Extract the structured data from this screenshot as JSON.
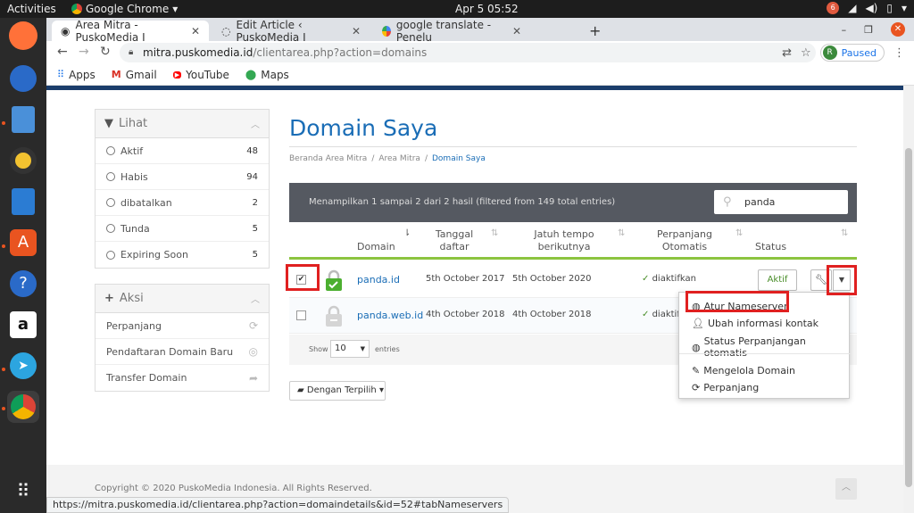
{
  "system": {
    "activities": "Activities",
    "app": "Google Chrome",
    "clock": "Apr 5  05:52",
    "notif_count": "6"
  },
  "browser": {
    "tabs": [
      {
        "title": "Area Mitra - PuskoMedia I",
        "active": true
      },
      {
        "title": "Edit Article ‹ PuskoMedia I",
        "active": false
      },
      {
        "title": "google translate - Penelu",
        "active": false
      }
    ],
    "url_host": "mitra.puskomedia.id",
    "url_path": "/clientarea.php?action=domains",
    "profile_initial": "R",
    "profile_status": "Paused",
    "bookmarks": [
      "Apps",
      "Gmail",
      "YouTube",
      "Maps"
    ],
    "status_url": "https://mitra.puskomedia.id/clientarea.php?action=domaindetails&id=52#tabNameservers"
  },
  "sidebar": {
    "lihat": {
      "title": "Lihat",
      "items": [
        {
          "label": "Aktif",
          "count": "48"
        },
        {
          "label": "Habis",
          "count": "94"
        },
        {
          "label": "dibatalkan",
          "count": "2"
        },
        {
          "label": "Tunda",
          "count": "5"
        },
        {
          "label": "Expiring Soon",
          "count": "5"
        }
      ]
    },
    "aksi": {
      "title": "Aksi",
      "items": [
        {
          "label": "Perpanjang"
        },
        {
          "label": "Pendaftaran Domain Baru"
        },
        {
          "label": "Transfer Domain"
        }
      ]
    }
  },
  "main": {
    "title": "Domain Saya",
    "breadcrumb": [
      "Beranda Area Mitra",
      "Area Mitra",
      "Domain Saya"
    ],
    "table_info": "Menampilkan 1 sampai 2 dari 2 hasil (filtered from 149 total entries)",
    "search_value": "panda",
    "columns": {
      "domain": "Domain",
      "reg_l1": "Tanggal",
      "reg_l2": "daftar",
      "exp_l1": "Jatuh tempo",
      "exp_l2": "berikutnya",
      "auto_l1": "Perpanjang",
      "auto_l2": "Otomatis",
      "status": "Status"
    },
    "rows": [
      {
        "domain": "panda.id",
        "registered": "5th October 2017",
        "expires": "5th October 2020",
        "auto": "diaktifkan",
        "status": "Aktif",
        "checked": true
      },
      {
        "domain": "panda.web.id",
        "registered": "4th October 2018",
        "expires": "4th October 2018",
        "auto": "diaktif",
        "status": "",
        "checked": false
      }
    ],
    "show_label": "Show",
    "show_value": "10",
    "entries_label": "entries",
    "bulk_button": "Dengan Terpilih",
    "menu": [
      "Atur Nameserver",
      "Ubah informasi kontak",
      "Status Perpanjangan otomatis",
      "Mengelola Domain",
      "Perpanjang"
    ],
    "copyright": "Copyright © 2020 PuskoMedia Indonesia. All Rights Reserved."
  },
  "colors": {
    "brand_blue": "#1a6db6",
    "active_green": "#4a8e2a",
    "highlight_red": "#e02020",
    "header_bar": "#555961",
    "dock": "#2a2a2a"
  }
}
